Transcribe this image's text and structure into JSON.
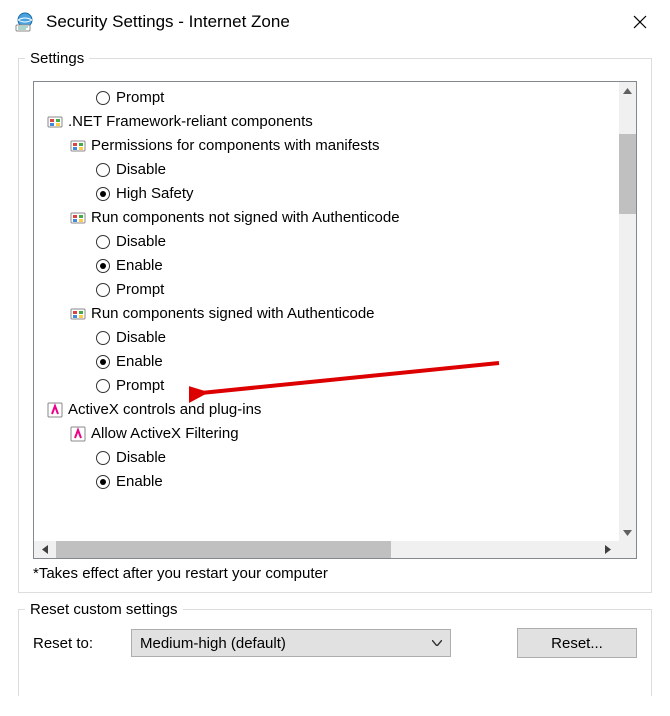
{
  "window": {
    "title": "Security Settings - Internet Zone"
  },
  "settings": {
    "legend": "Settings",
    "footnote": "*Takes effect after you restart your computer",
    "tree": [
      {
        "type": "radio",
        "level": 2,
        "checked": false,
        "label": "Prompt"
      },
      {
        "type": "group",
        "level": 0,
        "icon": "net-icon",
        "label": ".NET Framework-reliant components"
      },
      {
        "type": "group",
        "level": 1,
        "icon": "net-sub-icon",
        "label": "Permissions for components with manifests"
      },
      {
        "type": "radio",
        "level": 2,
        "checked": false,
        "label": "Disable"
      },
      {
        "type": "radio",
        "level": 2,
        "checked": true,
        "label": "High Safety"
      },
      {
        "type": "group",
        "level": 1,
        "icon": "net-sub-icon",
        "label": "Run components not signed with Authenticode"
      },
      {
        "type": "radio",
        "level": 2,
        "checked": false,
        "label": "Disable"
      },
      {
        "type": "radio",
        "level": 2,
        "checked": true,
        "label": "Enable"
      },
      {
        "type": "radio",
        "level": 2,
        "checked": false,
        "label": "Prompt"
      },
      {
        "type": "group",
        "level": 1,
        "icon": "net-sub-icon",
        "label": "Run components signed with Authenticode"
      },
      {
        "type": "radio",
        "level": 2,
        "checked": false,
        "label": "Disable"
      },
      {
        "type": "radio",
        "level": 2,
        "checked": true,
        "label": "Enable"
      },
      {
        "type": "radio",
        "level": 2,
        "checked": false,
        "label": "Prompt"
      },
      {
        "type": "group",
        "level": 0,
        "icon": "activex-icon",
        "label": "ActiveX controls and plug-ins"
      },
      {
        "type": "group",
        "level": 1,
        "icon": "activex-sub-icon",
        "label": "Allow ActiveX Filtering"
      },
      {
        "type": "radio",
        "level": 2,
        "checked": false,
        "label": "Disable"
      },
      {
        "type": "radio",
        "level": 2,
        "checked": true,
        "label": "Enable"
      }
    ]
  },
  "reset": {
    "legend": "Reset custom settings",
    "label": "Reset to:",
    "selected": "Medium-high (default)",
    "button": "Reset..."
  },
  "annotation": {
    "arrow_target_index": 11
  }
}
